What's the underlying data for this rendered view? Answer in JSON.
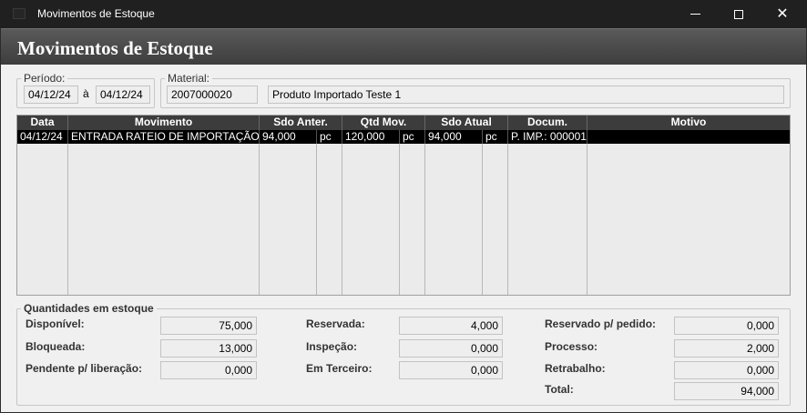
{
  "window": {
    "title": "Movimentos de Estoque",
    "minimize_icon": "minimize-icon",
    "maximize_icon": "maximize-icon",
    "close_icon": "close-icon",
    "close_glyph": "✕"
  },
  "header": {
    "title": "Movimentos de Estoque"
  },
  "periodo": {
    "label": "Período:",
    "from": "04/12/24",
    "separator": "à",
    "to": "04/12/24"
  },
  "material": {
    "label": "Material:",
    "code": "2007000020",
    "description": "Produto Importado Teste 1"
  },
  "grid": {
    "headers": [
      "Data",
      "Movimento",
      "Sdo Anter.",
      "Qtd Mov.",
      "Sdo Atual",
      "Docum.",
      "Motivo"
    ],
    "rows": [
      {
        "data": "04/12/24",
        "movimento": "ENTRADA RATEIO DE IMPORTAÇÃO",
        "sdo_anter": "94,000",
        "sdo_anter_un": "pc",
        "qtd_mov": "120,000",
        "qtd_mov_un": "pc",
        "sdo_atual": "94,000",
        "sdo_atual_un": "pc",
        "docum": "P. IMP.: 000001",
        "motivo": ""
      }
    ]
  },
  "quantidades": {
    "label": "Quantidades em estoque",
    "disponivel": {
      "label": "Disponível:",
      "value": "75,000"
    },
    "bloqueada": {
      "label": "Bloqueada:",
      "value": "13,000"
    },
    "pendente": {
      "label": "Pendente p/ liberação:",
      "value": "0,000"
    },
    "reservada": {
      "label": "Reservada:",
      "value": "4,000"
    },
    "inspecao": {
      "label": "Inspeção:",
      "value": "0,000"
    },
    "em_terceiro": {
      "label": "Em Terceiro:",
      "value": "0,000"
    },
    "reservado_pedido": {
      "label": "Reservado p/ pedido:",
      "value": "0,000"
    },
    "processo": {
      "label": "Processo:",
      "value": "2,000"
    },
    "retrabalho": {
      "label": "Retrabalho:",
      "value": "0,000"
    },
    "total": {
      "label": "Total:",
      "value": "94,000"
    }
  }
}
